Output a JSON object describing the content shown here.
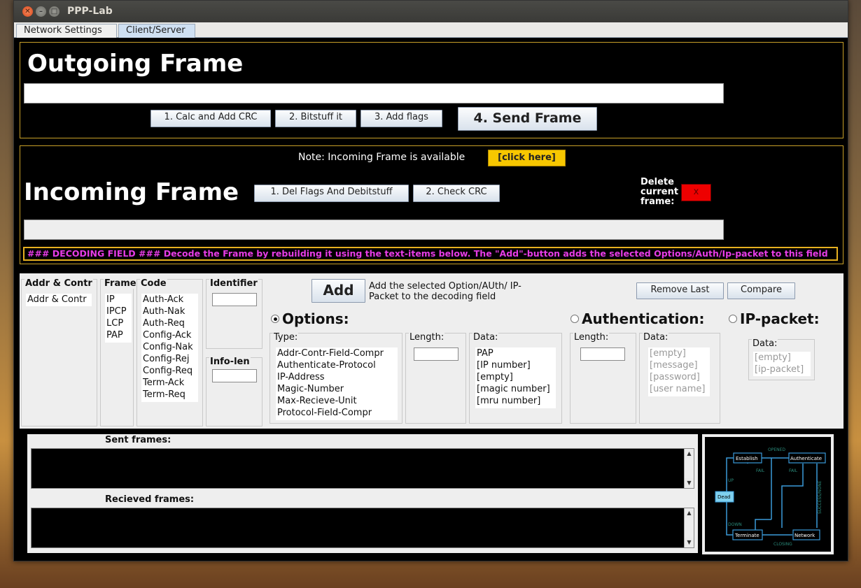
{
  "window": {
    "title": "PPP-Lab"
  },
  "tabs": [
    {
      "label": "Network Settings"
    },
    {
      "label": "Client/Server"
    }
  ],
  "outgoing": {
    "title": "Outgoing Frame",
    "frame_value": "",
    "buttons": {
      "calc_crc": "1. Calc and Add CRC",
      "bitstuff": "2. Bitstuff it",
      "add_flags": "3. Add flags",
      "send": "4. Send Frame"
    }
  },
  "incoming": {
    "note": "Note: Incoming Frame is available",
    "click_here": "[click here]",
    "title": "Incoming Frame",
    "buttons": {
      "del_flags": "1. Del Flags And Debitstuff",
      "check_crc": "2. Check CRC"
    },
    "delete_label": "Delete current frame:",
    "delete_btn": "x",
    "frame_value": ""
  },
  "decoding_field": "### DECODING FIELD ###     Decode the Frame by rebuilding it  using the text-items below. The \"Add\"-button adds the selected Options/Auth/Ip-packet to this field",
  "builder": {
    "addr_contr": {
      "title": "Addr & Contr",
      "items": [
        "Addr & Contr"
      ]
    },
    "frame": {
      "title": "Frame",
      "items": [
        "IP",
        "IPCP",
        "LCP",
        "PAP"
      ]
    },
    "code": {
      "title": "Code",
      "items": [
        "Auth-Ack",
        "Auth-Nak",
        "Auth-Req",
        "Config-Ack",
        "Config-Nak",
        "Config-Rej",
        "Config-Req",
        "Term-Ack",
        "Term-Req"
      ]
    },
    "identifier": {
      "title": "Identifier",
      "value": ""
    },
    "info_len": {
      "title": "Info-len",
      "value": ""
    }
  },
  "add_panel": {
    "add_btn": "Add",
    "add_desc": "Add the selected Option/AUth/ IP-Packet to the decoding field",
    "remove_last": "Remove Last",
    "compare": "Compare"
  },
  "options": {
    "title": "Options:",
    "selected": true,
    "type_title": "Type:",
    "types": [
      "Addr-Contr-Field-Compr",
      "Authenticate-Protocol",
      "IP-Address",
      "Magic-Number",
      "Max-Recieve-Unit",
      "Protocol-Field-Compr"
    ],
    "length_title": "Length:",
    "data_title": "Data:",
    "data": [
      "PAP",
      "[IP number]",
      "[empty]",
      "[magic number]",
      "[mru number]"
    ]
  },
  "authentication": {
    "title": "Authentication:",
    "length_title": "Length:",
    "data_title": "Data:",
    "data": [
      "[empty]",
      "[message]",
      "[password]",
      "[user name]"
    ]
  },
  "ip_packet": {
    "title": "IP-packet:",
    "data_title": "Data:",
    "data": [
      "[empty]",
      "[ip-packet]"
    ]
  },
  "logs": {
    "sent_label": "Sent frames:",
    "received_label": "Recieved frames:"
  },
  "diagram": {
    "states": [
      "Establish",
      "Authenticate",
      "Dead",
      "Terminate",
      "Network"
    ],
    "transitions": [
      "OPENED",
      "FAIL",
      "FAIL",
      "UP",
      "SUCCESS/NONE",
      "DOWN",
      "CLOSING"
    ]
  },
  "colors": {
    "panel_border": "#c8a028",
    "decoding_text": "#e63ce6",
    "click_here_bg": "#f7c700",
    "delete_bg": "#ee0000",
    "diagram_line": "#3a9ad9"
  }
}
